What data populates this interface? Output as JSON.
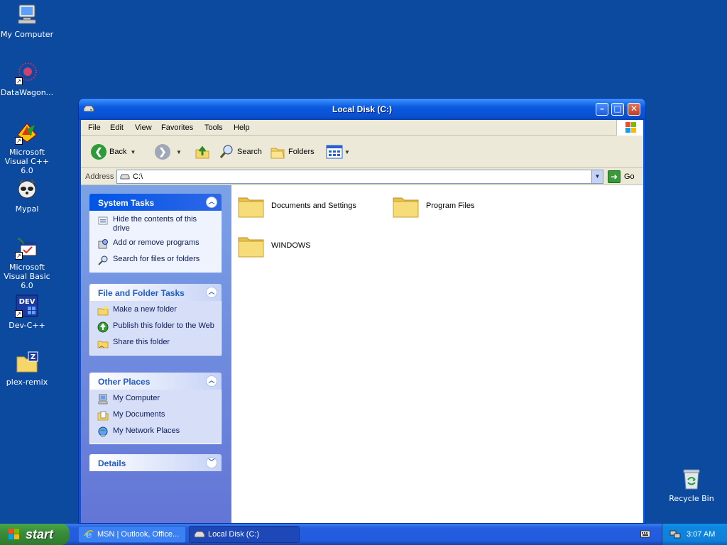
{
  "desktop": {
    "icons": [
      {
        "label": "My Computer",
        "icon": "my-computer-icon"
      },
      {
        "label": "DataWagon...",
        "icon": "datawagon-icon"
      },
      {
        "label": "Microsoft Visual C++ 6.0",
        "icon": "visual-cpp-icon"
      },
      {
        "label": "Mypal",
        "icon": "mypal-icon"
      },
      {
        "label": "Microsoft Visual Basic 6.0",
        "icon": "visual-basic-icon"
      },
      {
        "label": "Dev-C++",
        "icon": "dev-cpp-icon"
      },
      {
        "label": "plex-remix",
        "icon": "plex-remix-folder-icon"
      },
      {
        "label": "Recycle Bin",
        "icon": "recycle-bin-icon"
      }
    ]
  },
  "window": {
    "title": "Local Disk (C:)",
    "colors": {
      "titlebar": "#0a5ae0",
      "taskpane": "#7ba2e7",
      "desktop": "#0c4aa0"
    },
    "menu": [
      "File",
      "Edit",
      "View",
      "Favorites",
      "Tools",
      "Help"
    ],
    "toolbar": {
      "back": "Back",
      "search": "Search",
      "folders": "Folders"
    },
    "address": {
      "label": "Address",
      "value": "C:\\",
      "go": "Go"
    },
    "taskpane": {
      "system_tasks": {
        "title": "System Tasks",
        "items": [
          "Hide the contents of this drive",
          "Add or remove programs",
          "Search for files or folders"
        ]
      },
      "file_folder_tasks": {
        "title": "File and Folder Tasks",
        "items": [
          "Make a new folder",
          "Publish this folder to the Web",
          "Share this folder"
        ]
      },
      "other_places": {
        "title": "Other Places",
        "items": [
          "My Computer",
          "My Documents",
          "My Network Places"
        ]
      },
      "details": {
        "title": "Details"
      }
    },
    "files": [
      {
        "name": "Documents and Settings",
        "type": "folder"
      },
      {
        "name": "Program Files",
        "type": "folder"
      },
      {
        "name": "WINDOWS",
        "type": "folder"
      }
    ]
  },
  "taskbar": {
    "start": "start",
    "tasks": [
      {
        "label": "MSN | Outlook, Office...",
        "icon": "internet-explorer-icon",
        "active": false
      },
      {
        "label": "Local Disk (C:)",
        "icon": "drive-icon",
        "active": true
      }
    ],
    "clock": "3:07 AM"
  }
}
